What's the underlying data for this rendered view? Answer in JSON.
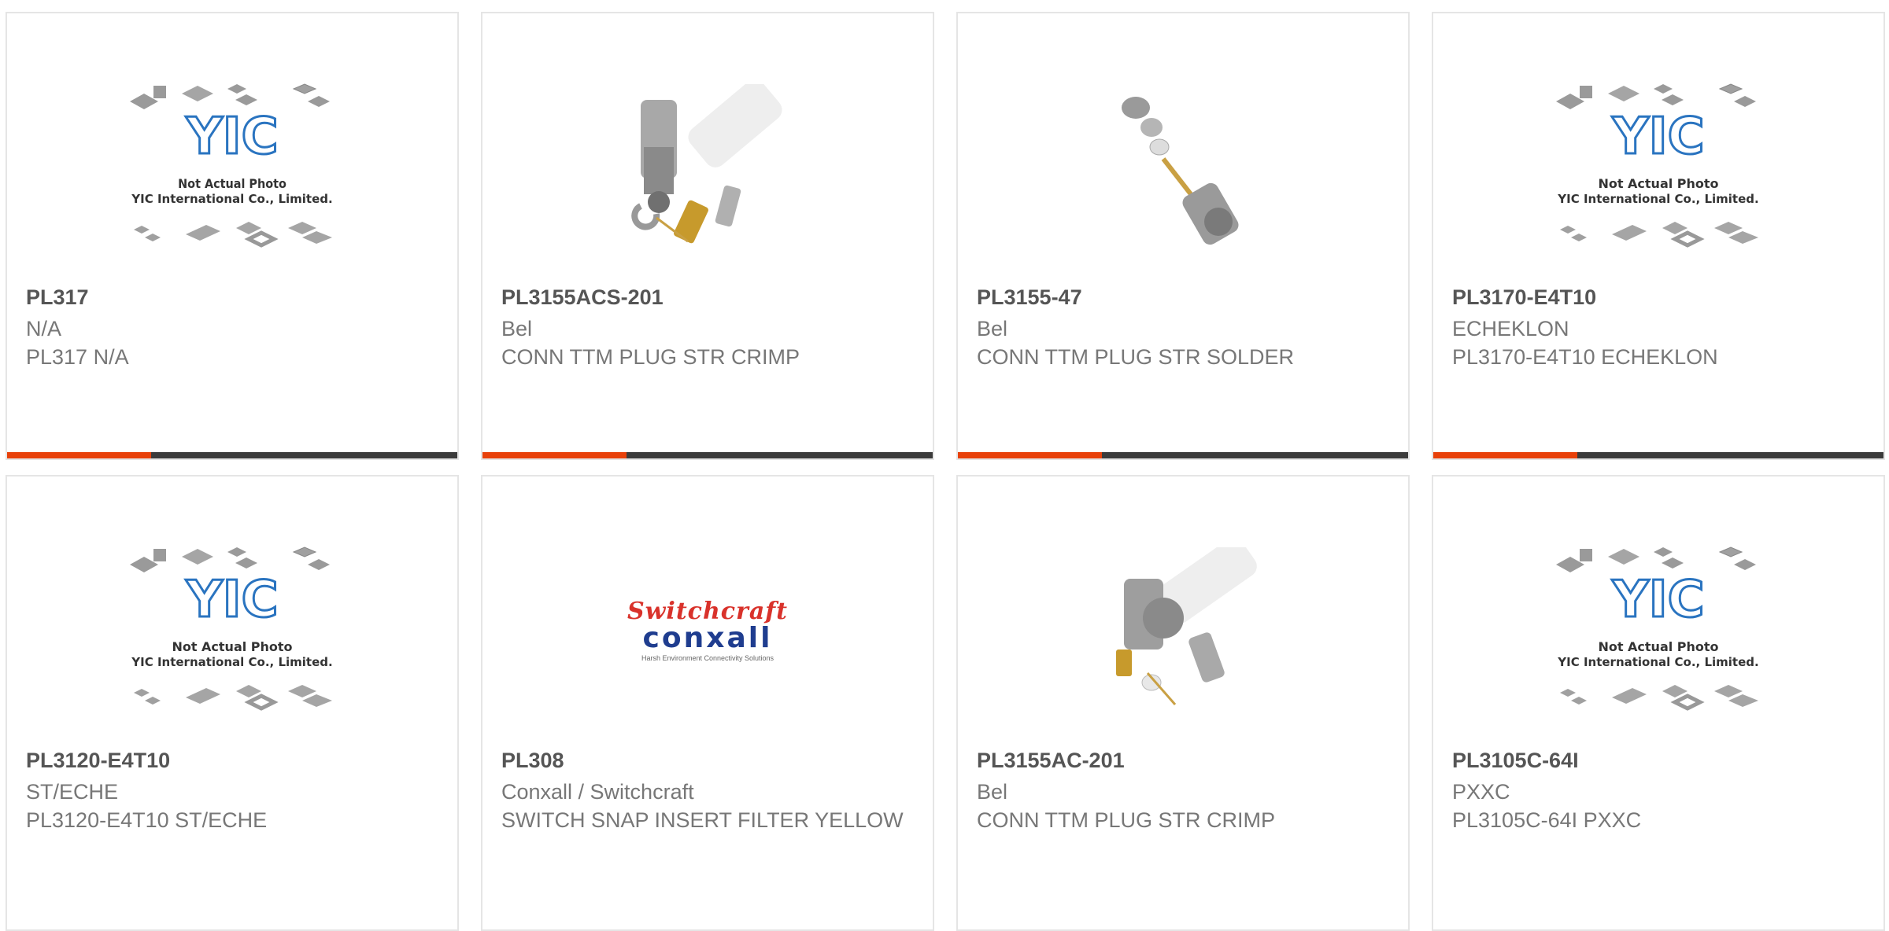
{
  "placeholder_image": {
    "line1": "Not Actual Photo",
    "line2": "YIC International Co., Limited."
  },
  "brand_logo": {
    "top": "Switchcraft",
    "mid": "conxall",
    "sub": "Harsh Environment Connectivity Solutions"
  },
  "colors": {
    "accent": "#e8410a",
    "bar_dark": "#3b3b3b",
    "yic_blue": "#2a74c0"
  },
  "products": [
    {
      "part": "PL317",
      "manufacturer": "N/A",
      "description": "PL317 N/A",
      "image": "placeholder"
    },
    {
      "part": "PL3155ACS-201",
      "manufacturer": "Bel",
      "description": "CONN TTM PLUG STR CRIMP",
      "image": "connector-kit"
    },
    {
      "part": "PL3155-47",
      "manufacturer": "Bel",
      "description": "CONN TTM PLUG STR SOLDER",
      "image": "connector-exploded"
    },
    {
      "part": "PL3170-E4T10",
      "manufacturer": "ECHEKLON",
      "description": "PL3170-E4T10 ECHEKLON",
      "image": "placeholder"
    },
    {
      "part": "PL3120-E4T10",
      "manufacturer": "ST/ECHE",
      "description": "PL3120-E4T10 ST/ECHE",
      "image": "placeholder"
    },
    {
      "part": "PL308",
      "manufacturer": "Conxall / Switchcraft",
      "description": "SWITCH SNAP INSERT FILTER YELLOW",
      "image": "brand-logo"
    },
    {
      "part": "PL3155AC-201",
      "manufacturer": "Bel",
      "description": "CONN TTM PLUG STR CRIMP",
      "image": "connector-kit"
    },
    {
      "part": "PL3105C-64I",
      "manufacturer": "PXXC",
      "description": "PL3105C-64I PXXC",
      "image": "placeholder"
    }
  ]
}
